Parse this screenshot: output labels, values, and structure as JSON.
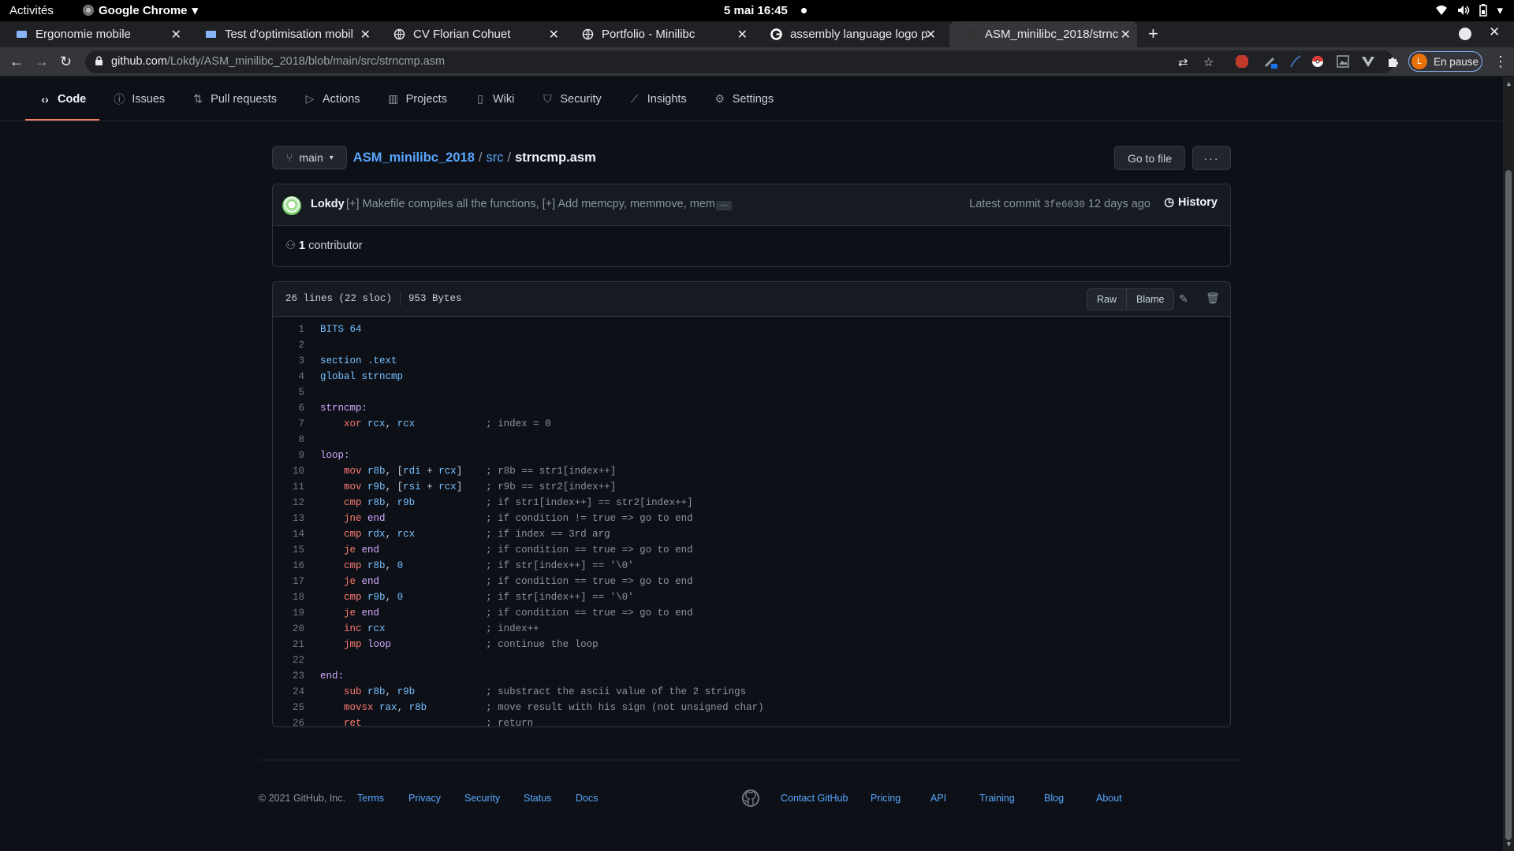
{
  "os_bar": {
    "activities": "Activités",
    "app_name": "Google Chrome",
    "clock": "5 mai  16:45"
  },
  "tabs": [
    {
      "title": "Ergonomie mobile",
      "icon": "doc-favicon"
    },
    {
      "title": "Test d'optimisation mobil",
      "icon": "doc-favicon"
    },
    {
      "title": "CV Florian Cohuet",
      "icon": "globe-favicon"
    },
    {
      "title": "Portfolio - Minilibc",
      "icon": "globe-favicon"
    },
    {
      "title": "assembly language logo p",
      "icon": "google-favicon"
    },
    {
      "title": "ASM_minilibc_2018/strnc",
      "icon": "github-favicon",
      "active": true
    }
  ],
  "omnibox": {
    "host": "github.com",
    "path": "/Lokdy/ASM_minilibc_2018/blob/main/src/strncmp.asm"
  },
  "profile": {
    "initial": "L",
    "label": "En pause"
  },
  "repo_nav": [
    {
      "label": "Code",
      "icon": "code-icon",
      "selected": true
    },
    {
      "label": "Issues",
      "icon": "issue-icon"
    },
    {
      "label": "Pull requests",
      "icon": "pull-request-icon"
    },
    {
      "label": "Actions",
      "icon": "play-icon"
    },
    {
      "label": "Projects",
      "icon": "project-icon"
    },
    {
      "label": "Wiki",
      "icon": "book-icon"
    },
    {
      "label": "Security",
      "icon": "shield-icon"
    },
    {
      "label": "Insights",
      "icon": "graph-icon"
    },
    {
      "label": "Settings",
      "icon": "gear-icon"
    }
  ],
  "breadcrumb": {
    "branch": "main",
    "repo": "ASM_minilibc_2018",
    "dir": "src",
    "file": "strncmp.asm"
  },
  "actions": {
    "go_to_file": "Go to file",
    "more": "···"
  },
  "commit": {
    "author": "Lokdy",
    "message": "[+] Makefile compiles all the functions, [+] Add memcpy, memmove, mem…",
    "ellipsis": "…",
    "latest_label": "Latest commit",
    "sha": "3fe6030",
    "age": "12 days ago",
    "history": "History"
  },
  "contributors": {
    "count": "1",
    "label": "contributor"
  },
  "file_info": {
    "lines": "26 lines (22 sloc)",
    "size": "953 Bytes",
    "raw": "Raw",
    "blame": "Blame"
  },
  "code_lines": [
    "BITS 64",
    "",
    "section .text",
    "global strncmp",
    "",
    "strncmp:",
    "    xor rcx, rcx            ; index = 0",
    "",
    "loop:",
    "    mov r8b, [rdi + rcx]    ; r8b == str1[index++]",
    "    mov r9b, [rsi + rcx]    ; r9b == str2[index++]",
    "    cmp r8b, r9b            ; if str1[index++] == str2[index++]",
    "    jne end                 ; if condition != true => go to end",
    "    cmp rdx, rcx            ; if index == 3rd arg",
    "    je end                  ; if condition == true => go to end",
    "    cmp r8b, 0              ; if str[index++] == '\\0'",
    "    je end                  ; if condition == true => go to end",
    "    cmp r9b, 0              ; if str[index++] == '\\0'",
    "    je end                  ; if condition == true => go to end",
    "    inc rcx                 ; index++",
    "    jmp loop                ; continue the loop",
    "",
    "end:",
    "    sub r8b, r9b            ; substract the ascii value of the 2 strings",
    "    movsx rax, r8b          ; move result with his sign (not unsigned char)",
    "    ret                     ; return"
  ],
  "footer": {
    "copyright": "© 2021 GitHub, Inc.",
    "links_left": [
      "Terms",
      "Privacy",
      "Security",
      "Status",
      "Docs"
    ],
    "links_right": [
      "Contact GitHub",
      "Pricing",
      "API",
      "Training",
      "Blog",
      "About"
    ]
  },
  "colors": {
    "background": "#0d1117",
    "link": "#58a6ff",
    "keyword": "#ff7b72",
    "register": "#79c0ff",
    "label": "#d2a8ff",
    "comment": "#8b949e",
    "selected_tab_underline": "#f78166"
  }
}
